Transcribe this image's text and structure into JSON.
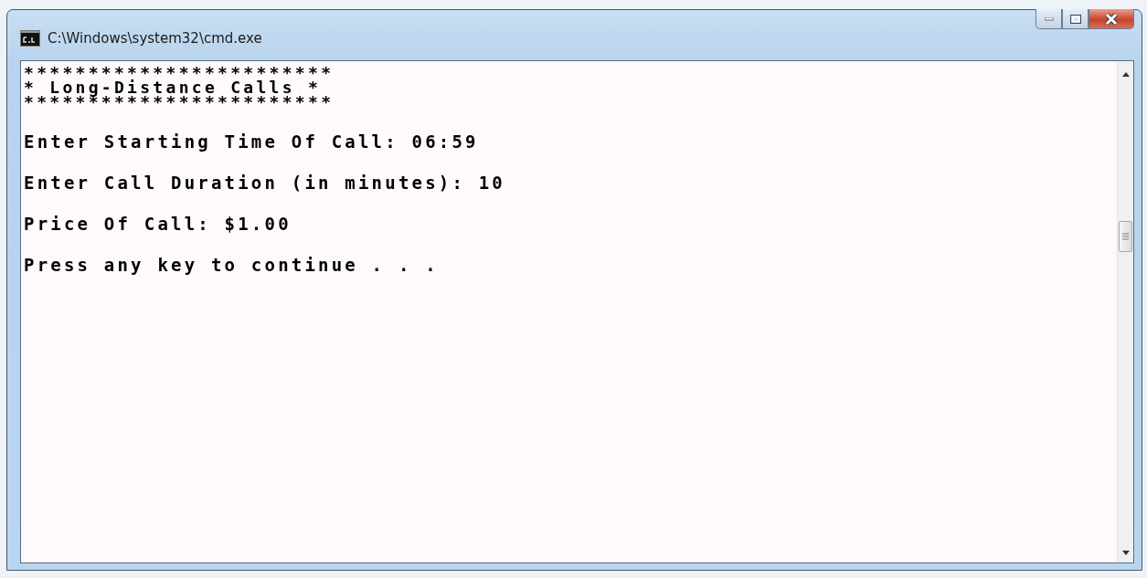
{
  "window": {
    "title": "C:\\Windows\\system32\\cmd.exe"
  },
  "console": {
    "banner": [
      "************************",
      "* Long-Distance Calls *",
      "************************"
    ],
    "lines": [
      "Enter Starting Time Of Call: 06:59",
      "Enter Call Duration (in minutes): 10",
      "Price Of Call: $1.00",
      "Press any key to continue . . ."
    ]
  }
}
